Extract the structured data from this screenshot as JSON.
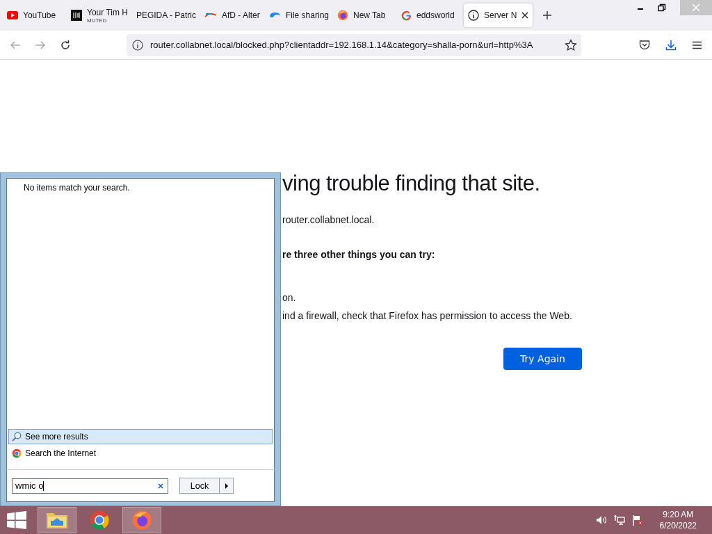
{
  "browser": {
    "tabs": [
      {
        "title": "YouTube",
        "kind": "youtube",
        "selected": false
      },
      {
        "title": "Your Tim H",
        "sublabel": "MUTED",
        "kind": "dark",
        "selected": false
      },
      {
        "title": "PEGIDA - Patric",
        "kind": "none",
        "selected": false
      },
      {
        "title": "AfD - Alter",
        "kind": "afd",
        "selected": false
      },
      {
        "title": "File sharing",
        "kind": "cloud",
        "selected": false
      },
      {
        "title": "New Tab",
        "kind": "firefox",
        "selected": false
      },
      {
        "title": "eddsworld",
        "kind": "google",
        "selected": false
      },
      {
        "title": "Server N",
        "kind": "info",
        "selected": true
      }
    ],
    "url": "router.collabnet.local/blocked.php?clientaddr=192.168.1.14&category=shalla-porn&url=http%3A"
  },
  "page": {
    "heading": "ving trouble finding that site.",
    "lines": [
      {
        "text": "router.collabnet.local.",
        "kind": "plain"
      },
      {
        "text": "re three other things you can try:",
        "kind": "bold"
      },
      {
        "text": "on.",
        "kind": "plain"
      },
      {
        "text": "ind a firewall, check that Firefox has permission to access the Web.",
        "kind": "plain"
      }
    ],
    "button": "Try Again"
  },
  "start_menu": {
    "message": "No items match your search.",
    "links": [
      {
        "label": "See more results",
        "kind": "search",
        "selected": true
      },
      {
        "label": "Search the Internet",
        "kind": "chrome",
        "selected": false
      }
    ],
    "search_value": "wmic o",
    "power_button": "Lock"
  },
  "taskbar": {
    "apps": [
      {
        "kind": "explorer",
        "active": true
      },
      {
        "kind": "chrome",
        "active": false
      },
      {
        "kind": "firefox",
        "active": true
      }
    ],
    "time": "9:20 AM",
    "date": "6/20/2022"
  }
}
